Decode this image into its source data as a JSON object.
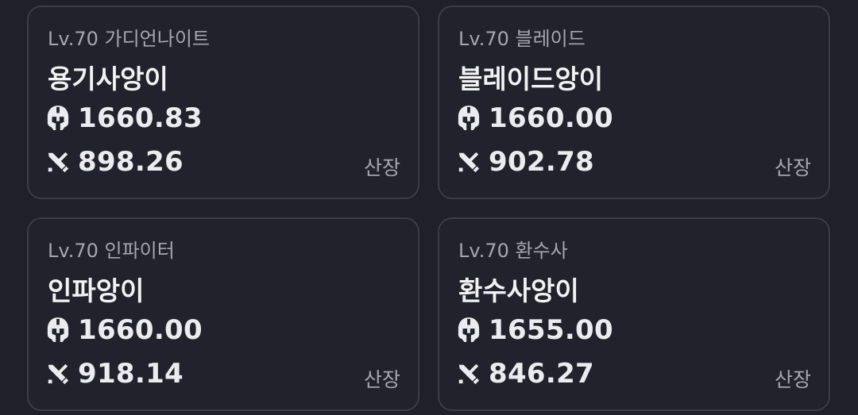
{
  "characters": [
    {
      "class_label": "Lv.70 가디언나이트",
      "name": "용기사앙이",
      "item_level": "1660.83",
      "combat_power": "898.26",
      "server": "산장"
    },
    {
      "class_label": "Lv.70 블레이드",
      "name": "블레이드앙이",
      "item_level": "1660.00",
      "combat_power": "902.78",
      "server": "산장"
    },
    {
      "class_label": "Lv.70 인파이터",
      "name": "인파앙이",
      "item_level": "1660.00",
      "combat_power": "918.14",
      "server": "산장"
    },
    {
      "class_label": "Lv.70 환수사",
      "name": "환수사앙이",
      "item_level": "1655.00",
      "combat_power": "846.27",
      "server": "산장"
    }
  ],
  "icons": {
    "item_level": "spartan-helmet-icon",
    "combat_power": "percent-swords-icon"
  },
  "colors": {
    "background": "#20202a",
    "card_border": "#3c3c48",
    "text_primary": "#f2f2f4",
    "text_secondary": "#a6a6b0"
  }
}
